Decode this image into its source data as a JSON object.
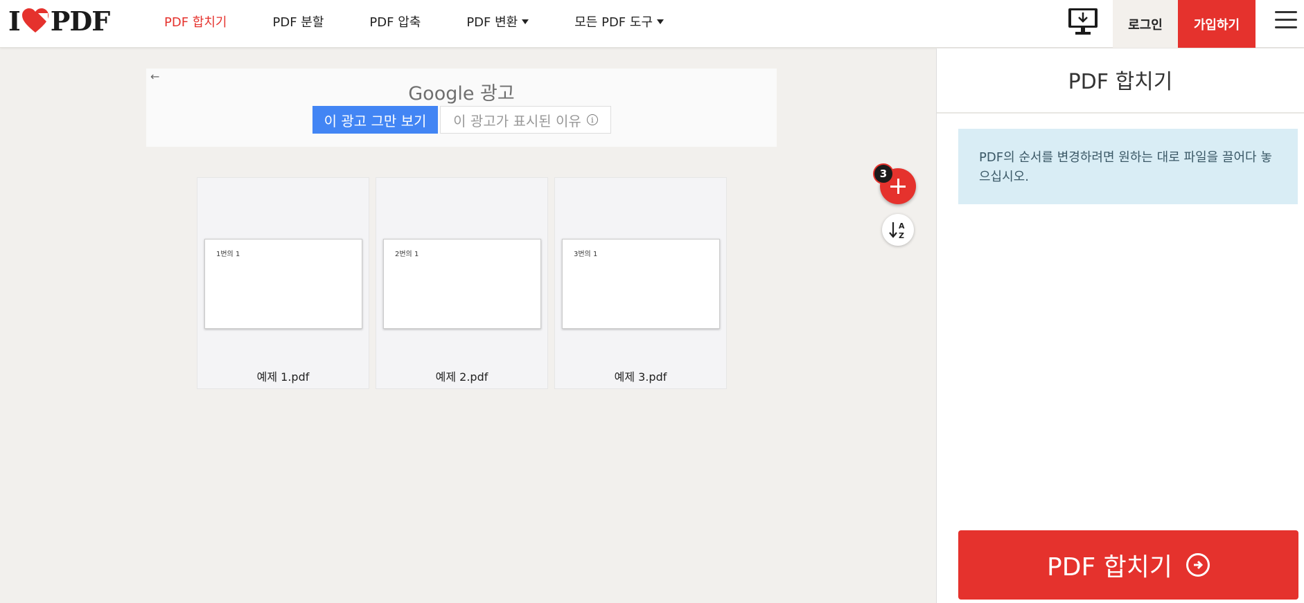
{
  "header": {
    "logo_left": "I",
    "logo_right": "PDF",
    "nav": [
      {
        "label": "PDF 합치기",
        "active": true
      },
      {
        "label": "PDF 분할",
        "active": false
      },
      {
        "label": "PDF 압축",
        "active": false
      },
      {
        "label": "PDF 변환",
        "active": false,
        "dropdown": true
      },
      {
        "label": "모든 PDF 도구",
        "active": false,
        "dropdown": true
      }
    ],
    "desktop_icon": "desktop-download-icon",
    "login": "로그인",
    "signup": "가입하기",
    "menu_icon": "hamburger-menu-icon"
  },
  "ad": {
    "brand": "Google 광고",
    "stop_label": "이 광고 그만 보기",
    "why_label": "이 광고가 표시된 이유"
  },
  "files": [
    {
      "page_text": "1번의 1",
      "name": "예제 1.pdf"
    },
    {
      "page_text": "2번의 1",
      "name": "예제 2.pdf"
    },
    {
      "page_text": "3번의 1",
      "name": "예제 3.pdf"
    }
  ],
  "toolbar": {
    "file_count": "3",
    "add_icon": "plus-icon",
    "sort_icon": "sort-az-icon"
  },
  "sidebar": {
    "title": "PDF 합치기",
    "hint": "PDF의 순서를 변경하려면 원하는 대로 파일을 끌어다 놓으십시오.",
    "merge_label": "PDF 합치기"
  },
  "colors": {
    "brand": "#e5322d",
    "ad_blue": "#4285f4",
    "hint_bg": "#d9edf5"
  }
}
